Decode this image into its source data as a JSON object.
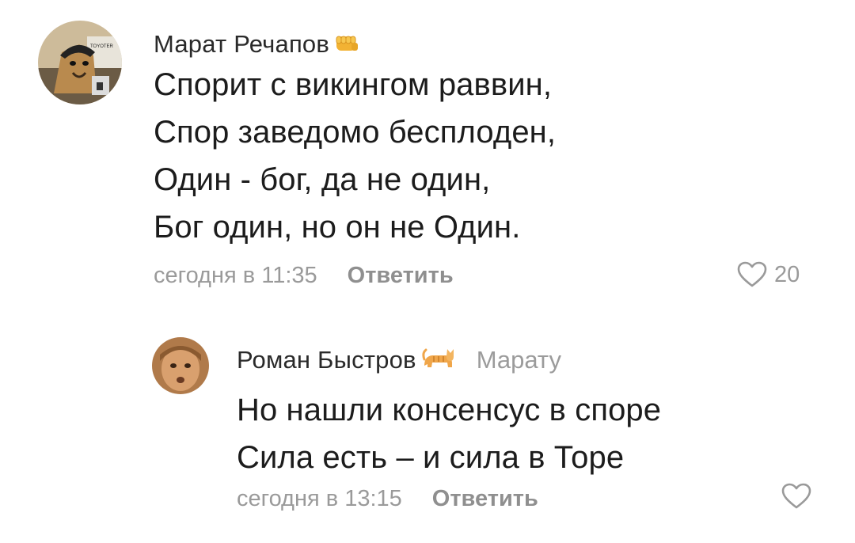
{
  "comments": [
    {
      "author": "Марат Речапов",
      "badge_icon": "fist-emoji",
      "lines": [
        "Спорит с викингом раввин,",
        "Спор заведомо бесплоден,",
        "Один - бог, да не один,",
        "Бог один, но он не Один."
      ],
      "time": "сегодня в 11:35",
      "reply_label": "Ответить",
      "likes": "20",
      "avatar_text": "TOYOTER"
    },
    {
      "author": "Роман Быстров",
      "badge_icon": "cat-emoji",
      "reply_to": "Марату",
      "lines": [
        "Но нашли консенсус в споре",
        "Сила есть – и сила в Торе"
      ],
      "time": "сегодня в 13:15",
      "reply_label": "Ответить"
    }
  ],
  "colors": {
    "text": "#1c1c1c",
    "secondary": "#9a9a9a",
    "like_outline": "#9a9a9a"
  }
}
